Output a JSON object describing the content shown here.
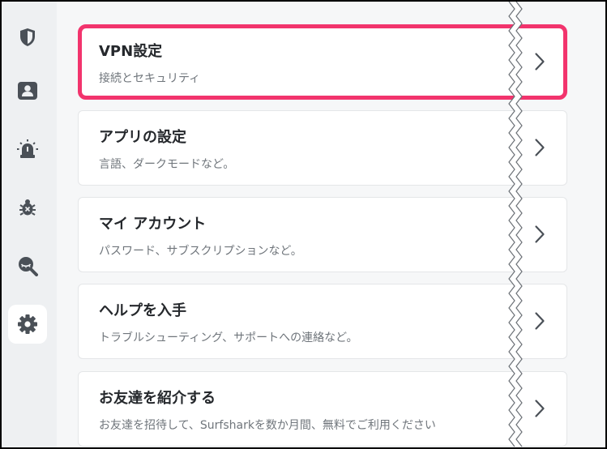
{
  "sidebar": {
    "items": [
      {
        "icon": "shield-icon"
      },
      {
        "icon": "user-profile-icon"
      },
      {
        "icon": "alert-light-icon"
      },
      {
        "icon": "bug-icon"
      },
      {
        "icon": "search-eye-icon"
      },
      {
        "icon": "gear-icon",
        "active": true
      }
    ]
  },
  "cards": [
    {
      "title": "VPN設定",
      "subtitle": "接続とセキュリティ"
    },
    {
      "title": "アプリの設定",
      "subtitle": "言語、ダークモードなど。"
    },
    {
      "title": "マイ アカウント",
      "subtitle": "パスワード、サブスクリプションなど。"
    },
    {
      "title": "ヘルプを入手",
      "subtitle": "トラブルシューティング、サポートへの連絡など。"
    },
    {
      "title": "お友達を紹介する",
      "subtitle": "お友達を招待して、Surfsharkを数か月間、無料でご利用ください"
    }
  ],
  "colors": {
    "highlight": "#f2346d",
    "icon": "#4a5057",
    "sidebar_bg": "#eef0f2",
    "content_bg": "#f6f7f8"
  }
}
